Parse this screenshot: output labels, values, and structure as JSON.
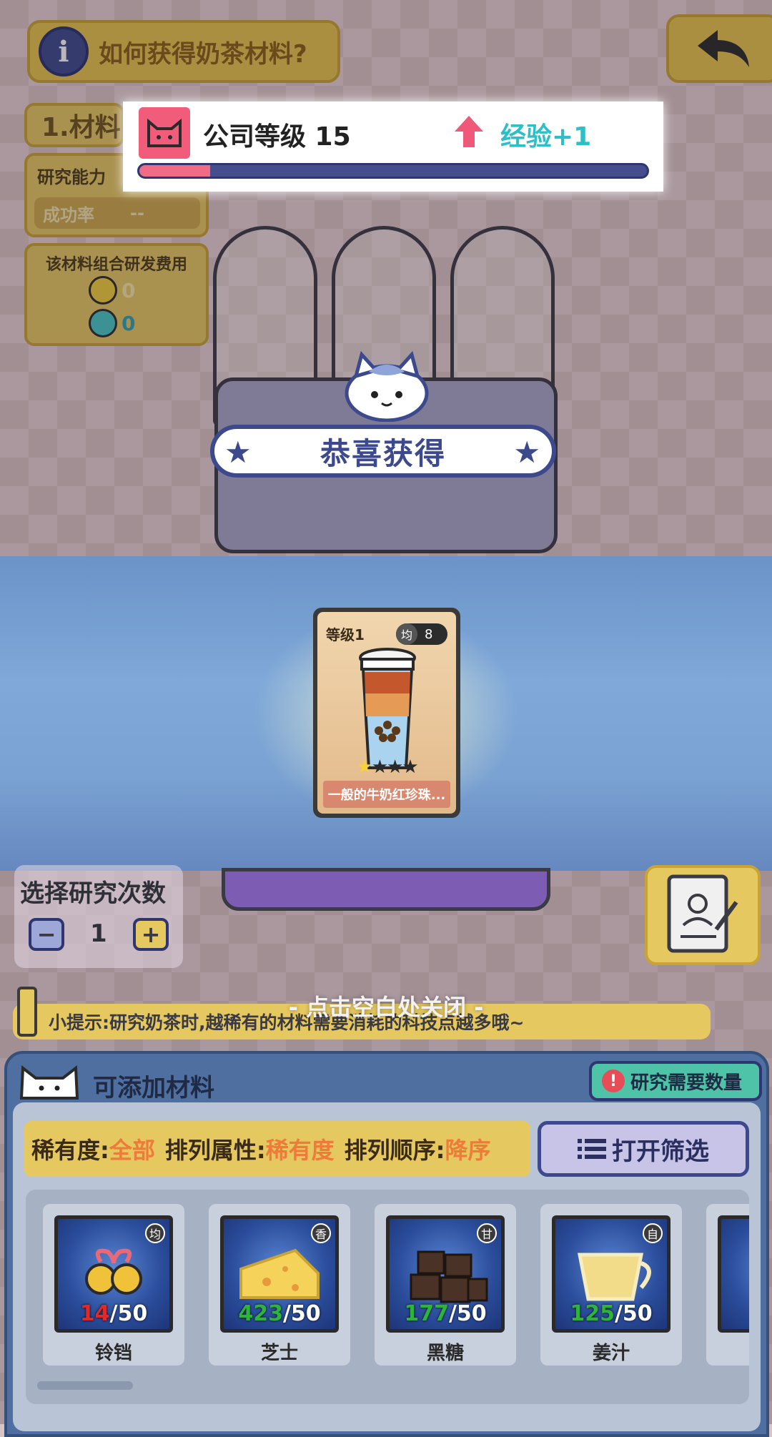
{
  "help": {
    "label": "如何获得奶茶材料?"
  },
  "left_panel": {
    "step_label": "1.材料",
    "research_ability_label": "研究能力",
    "success_rate_label": "成功率",
    "success_rate_value": "--",
    "cost_title": "该材料组合研发费用",
    "cost_coins": "0",
    "cost_tech": "0"
  },
  "level": {
    "title": "公司等级 15",
    "exp": "经验+1",
    "progress": 0.14
  },
  "reward": {
    "banner": "恭喜获得",
    "card": {
      "level": "等级1",
      "type_tag": "均",
      "value": "8",
      "stars": 1,
      "max_stars": 4,
      "name": "一般的牛奶红珍珠..."
    }
  },
  "count": {
    "title": "选择研究次数",
    "value": "1",
    "minus": "−",
    "plus": "+"
  },
  "close_hint": "- 点击空白处关闭 -",
  "tip": "小提示:研究奶茶时,越稀有的材料需要消耗的科技点越多哦~",
  "materials_panel": {
    "title": "可添加材料",
    "required_button": "研究需要数量",
    "sort": {
      "rarity_label": "稀有度:",
      "rarity_value": "全部",
      "attr_label": "排列属性:",
      "attr_value": "稀有度",
      "order_label": "排列顺序:",
      "order_value": "降序"
    },
    "filter_button": "打开筛选",
    "items": [
      {
        "name": "铃铛",
        "tag": "均",
        "have": "14",
        "max": "/50",
        "low": true
      },
      {
        "name": "芝士",
        "tag": "香",
        "have": "423",
        "max": "/50",
        "low": false
      },
      {
        "name": "黑糖",
        "tag": "甘",
        "have": "177",
        "max": "/50",
        "low": false
      },
      {
        "name": "姜汁",
        "tag": "自",
        "have": "125",
        "max": "/50",
        "low": false
      }
    ]
  },
  "colors": {
    "accent_yellow": "#e6c860",
    "navy": "#3c4a8d",
    "exp_teal": "#2bbfc7",
    "pink": "#f25c7b"
  }
}
